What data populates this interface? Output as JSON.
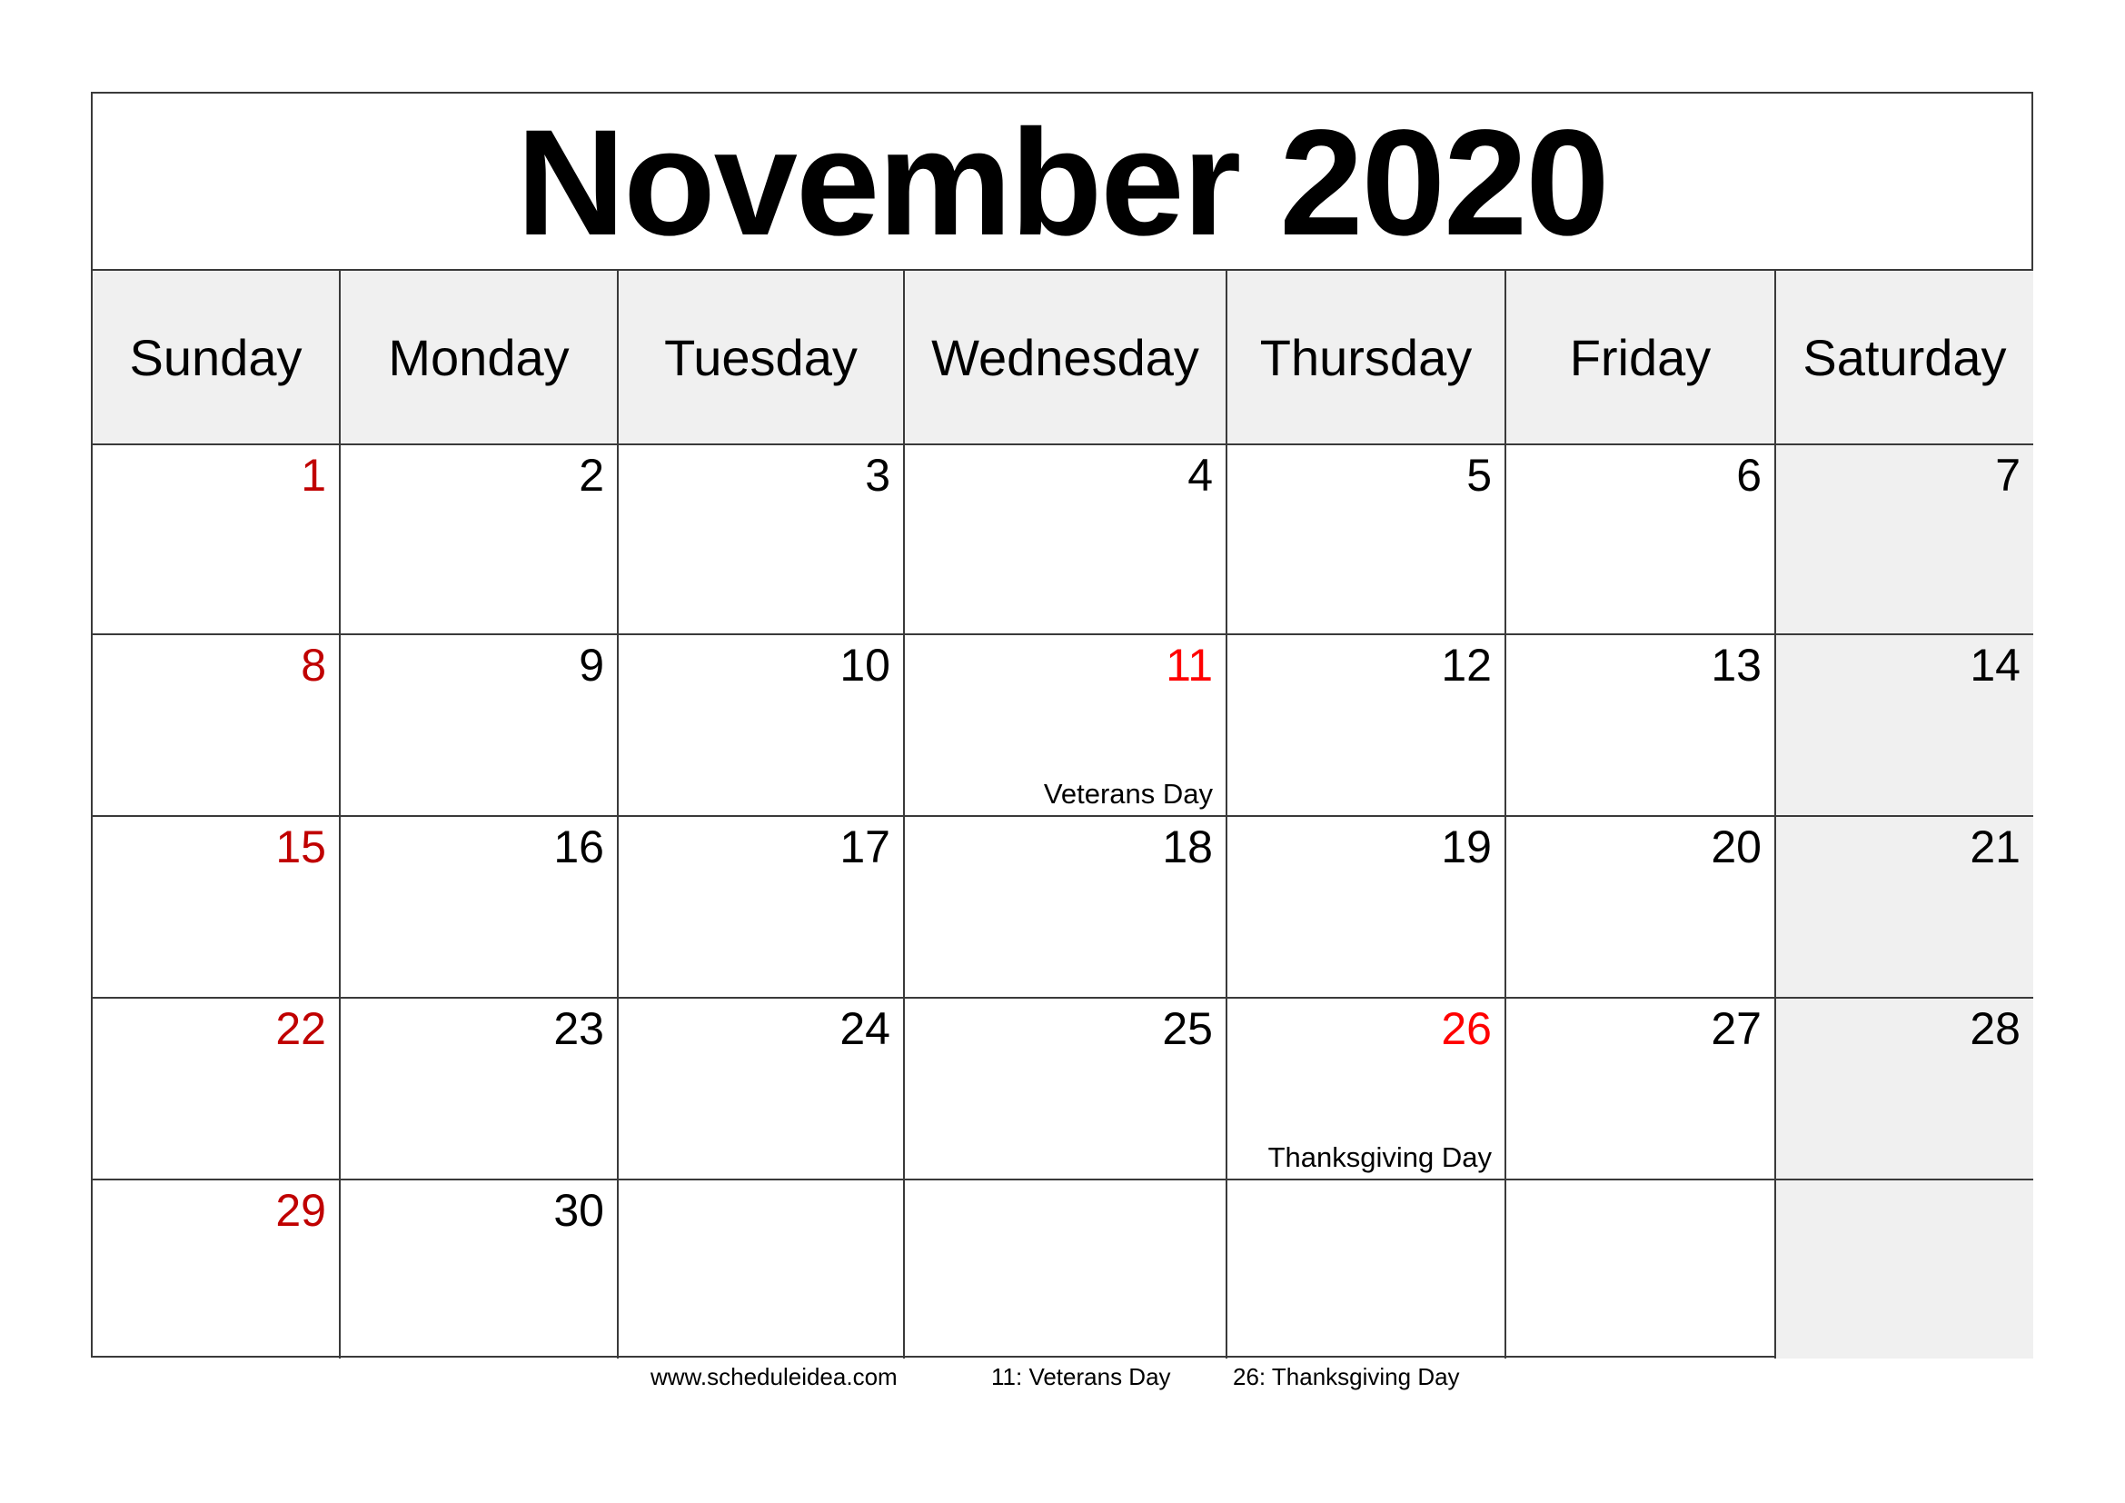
{
  "calendar": {
    "title": "November 2020",
    "weekdays": [
      "Sunday",
      "Monday",
      "Tuesday",
      "Wednesday",
      "Thursday",
      "Friday",
      "Saturday"
    ],
    "weeks": [
      [
        {
          "day": "1",
          "type": "sunday"
        },
        {
          "day": "2"
        },
        {
          "day": "3"
        },
        {
          "day": "4"
        },
        {
          "day": "5"
        },
        {
          "day": "6"
        },
        {
          "day": "7"
        }
      ],
      [
        {
          "day": "8",
          "type": "sunday"
        },
        {
          "day": "9"
        },
        {
          "day": "10"
        },
        {
          "day": "11",
          "type": "holiday",
          "note": "Veterans Day"
        },
        {
          "day": "12"
        },
        {
          "day": "13"
        },
        {
          "day": "14"
        }
      ],
      [
        {
          "day": "15",
          "type": "sunday"
        },
        {
          "day": "16"
        },
        {
          "day": "17"
        },
        {
          "day": "18"
        },
        {
          "day": "19"
        },
        {
          "day": "20"
        },
        {
          "day": "21"
        }
      ],
      [
        {
          "day": "22",
          "type": "sunday"
        },
        {
          "day": "23"
        },
        {
          "day": "24"
        },
        {
          "day": "25"
        },
        {
          "day": "26",
          "type": "holiday",
          "note": "Thanksgiving Day"
        },
        {
          "day": "27"
        },
        {
          "day": "28"
        }
      ],
      [
        {
          "day": "29",
          "type": "sunday"
        },
        {
          "day": "30"
        },
        {
          "day": ""
        },
        {
          "day": ""
        },
        {
          "day": ""
        },
        {
          "day": ""
        },
        {
          "day": ""
        }
      ]
    ]
  },
  "footer": {
    "website": "www.scheduleidea.com",
    "holiday_1": "11: Veterans Day",
    "holiday_2": "26: Thanksgiving Day"
  },
  "colors": {
    "sunday_red": "#c00000",
    "holiday_red": "#ff0000",
    "shade_gray": "#f0f0f0",
    "border": "#3a3a3a"
  }
}
